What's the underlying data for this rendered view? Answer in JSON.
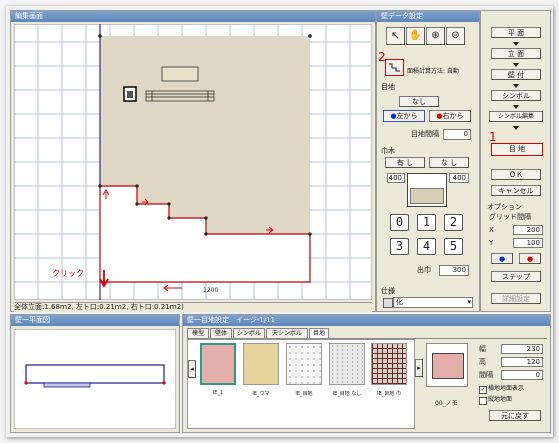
{
  "layout_window": {
    "title": "編集画面"
  },
  "status_bar": {
    "text": "全体立面:1.68ｍ2, 左ト口:0.21ｍ2, 右ト口:0.21ｍ2)"
  },
  "canvas": {
    "click_label": "クリック",
    "dimension": "1200",
    "annotation_numbers": {
      "n1": "1",
      "n2": "2"
    },
    "colors": {
      "highlight": "#ff0000",
      "wall": "#e0d8c4",
      "grid": "#9eb0d8",
      "accent": "#0000cc"
    }
  },
  "wall_panel": {
    "title": "壁データ設定",
    "tool_icons": [
      "pointer-icon",
      "hand-icon",
      "zoom-in-icon",
      "zoom-out-icon"
    ],
    "line_tool_icon": "polyline-icon",
    "area_label": "面積計算方法: 自動",
    "mokuchi": {
      "section": "目地",
      "none_button": "なし",
      "left_button": "左から",
      "right_button": "右から",
      "spacing_label": "目地間隔",
      "spacing_value": "0"
    },
    "habaki": {
      "section": "巾木",
      "left_button": "有 し",
      "right_button": "な し",
      "left_value": "400",
      "right_value": "400"
    },
    "numbers": [
      "0",
      "1",
      "2",
      "3",
      "4",
      "5"
    ],
    "height_label": "出巾",
    "height_value": "300",
    "finish": {
      "section": "仕様",
      "value": "化"
    }
  },
  "right_buttons": {
    "front": "平 面",
    "elevation": "立 面",
    "wall": "壁 付",
    "symbol": "シンボル",
    "symbol_edit": "シンボル編集",
    "mokuchi": "目 地",
    "ok": "ＯＫ",
    "cancel": "キャンセル"
  },
  "options": {
    "section": "オプション",
    "grid_label": "グリッド間隔",
    "x_label": "X",
    "x_value": "200",
    "y_label": "Y",
    "y_value": "100",
    "step_button": "ステップ",
    "other_button": "詳細設定"
  },
  "preview_window": {
    "title": "壁一平面図"
  },
  "material_window": {
    "title": "壁一目地設定　イージ-1/11",
    "tabs": [
      "模型",
      "壁体",
      "シンボル",
      "天シンボル",
      "目地"
    ],
    "swatches": [
      {
        "caption": "IE_1",
        "color": "#e2aeaa"
      },
      {
        "caption": "IE_ウマ",
        "color": "#e6d49c"
      },
      {
        "caption": "IE_目地",
        "color": "#f6f6f6"
      },
      {
        "caption": "IE_目地 なし",
        "color": "#e9e9e9"
      },
      {
        "caption": "IE_目地 巾",
        "color": "#d8d0c4"
      }
    ],
    "preview_caption": "00_ノモ",
    "field_labels": {
      "w": "幅",
      "h": "高",
      "r": "間隔"
    },
    "field_values": {
      "w": "230",
      "h": "120",
      "r": "0"
    },
    "check_labels": {
      "c1": "横地地面表示",
      "c2": "縦地地面"
    },
    "apply_button": "元に戻す"
  }
}
